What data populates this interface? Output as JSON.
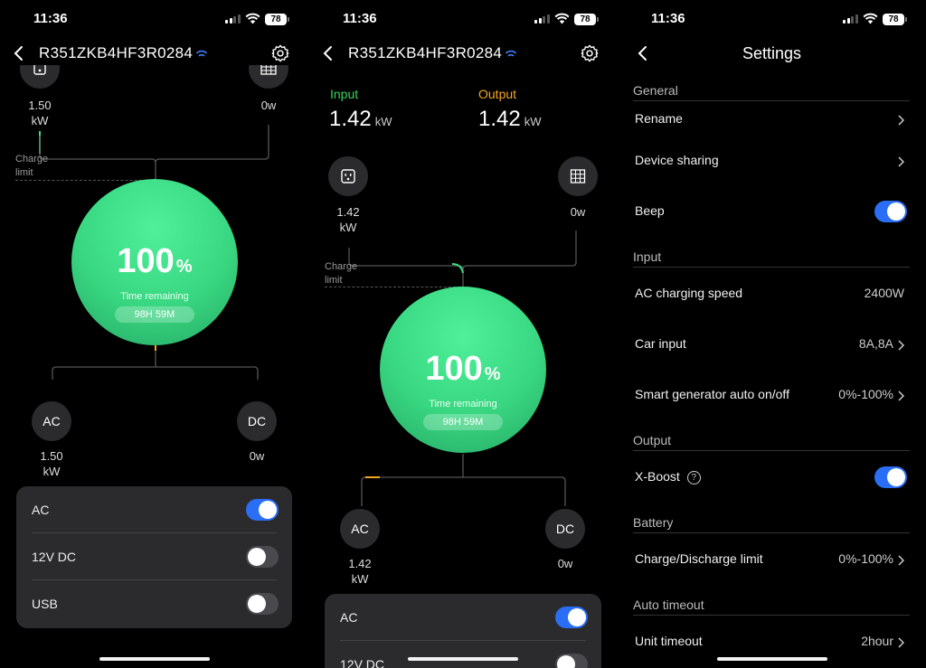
{
  "status": {
    "time": "11:36",
    "battery": "78"
  },
  "panel1": {
    "device_name": "R351ZKB4HF3R0284",
    "input_value": "1.50",
    "input_unit": "kW",
    "output_value": "0w",
    "charge_limit_l1": "Charge",
    "charge_limit_l2": "limit",
    "percent": "100",
    "percent_sign": "%",
    "time_remaining_label": "Time remaining",
    "time_remaining_value": "98H 59M",
    "ac_label": "AC",
    "ac_value": "1.50",
    "ac_unit": "kW",
    "dc_label": "DC",
    "dc_value": "0w",
    "toggles": [
      {
        "label": "AC",
        "on": true
      },
      {
        "label": "12V DC",
        "on": false
      },
      {
        "label": "USB",
        "on": false
      }
    ]
  },
  "panel2": {
    "device_name": "R351ZKB4HF3R0284",
    "input_label": "Input",
    "input_total": "1.42",
    "output_label": "Output",
    "output_total": "1.42",
    "total_unit": "kW",
    "input_value": "1.42",
    "input_unit": "kW",
    "output_value": "0w",
    "charge_limit_l1": "Charge",
    "charge_limit_l2": "limit",
    "percent": "100",
    "percent_sign": "%",
    "time_remaining_label": "Time remaining",
    "time_remaining_value": "98H 59M",
    "ac_label": "AC",
    "ac_value": "1.42",
    "ac_unit": "kW",
    "dc_label": "DC",
    "dc_value": "0w",
    "toggles": [
      {
        "label": "AC",
        "on": true
      },
      {
        "label": "12V DC",
        "on": false
      }
    ]
  },
  "settings": {
    "title": "Settings",
    "general": "General",
    "rename": "Rename",
    "device_sharing": "Device sharing",
    "beep": "Beep",
    "input": "Input",
    "ac_charging_speed": "AC charging speed",
    "ac_charging_speed_value": "2400W",
    "car_input": "Car input",
    "car_input_value": "8A,8A",
    "smart_generator": "Smart generator auto on/off",
    "smart_generator_value": "0%-100%",
    "output": "Output",
    "x_boost": "X-Boost",
    "help_symbol": "?",
    "battery": "Battery",
    "charge_discharge_limit": "Charge/Discharge limit",
    "charge_discharge_limit_value": "0%-100%",
    "auto_timeout": "Auto timeout",
    "unit_timeout": "Unit timeout",
    "unit_timeout_value": "2hour"
  },
  "colors": {
    "accent_blue": "#2a6ef5",
    "input_green": "#34d55a",
    "output_orange": "#f5a623",
    "ring_green": "#3ddc84"
  },
  "icons": [
    "back-chevron-icon",
    "bluetooth-signal-icon",
    "gear-icon",
    "ac-outlet-icon",
    "solar-panel-icon",
    "chevron-right-icon",
    "help-circle-icon"
  ]
}
